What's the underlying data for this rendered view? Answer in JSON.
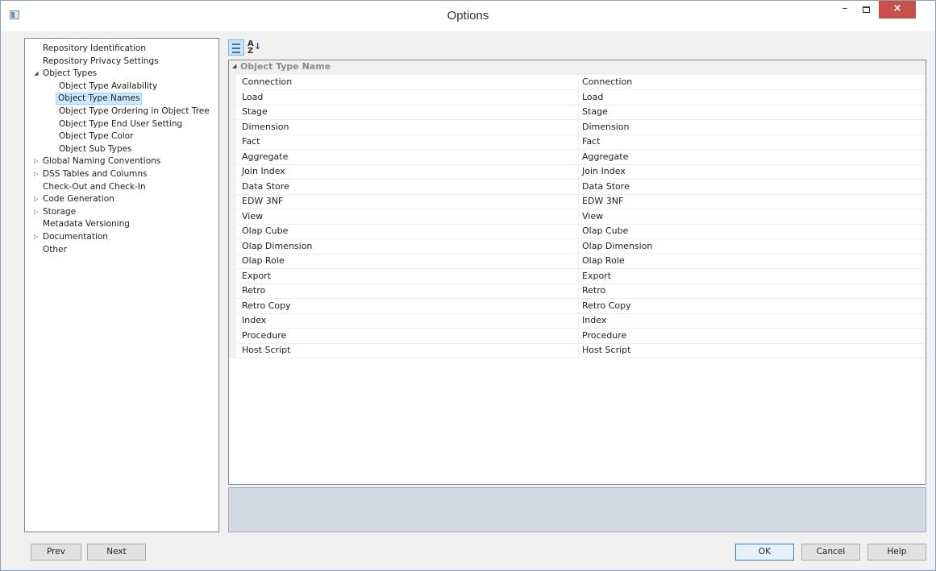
{
  "window": {
    "title": "Options",
    "minimize_glyph": "–",
    "close_glyph": "×"
  },
  "tree": [
    {
      "label": "Repository Identification",
      "level": 0,
      "toggle": ""
    },
    {
      "label": "Repository Privacy Settings",
      "level": 0,
      "toggle": ""
    },
    {
      "label": "Object Types",
      "level": 0,
      "toggle": "◢"
    },
    {
      "label": "Object Type Availability",
      "level": 1,
      "toggle": ""
    },
    {
      "label": "Object Type Names",
      "level": 1,
      "toggle": "",
      "selected": true
    },
    {
      "label": "Object Type Ordering in Object Tree",
      "level": 1,
      "toggle": ""
    },
    {
      "label": "Object Type End User Setting",
      "level": 1,
      "toggle": ""
    },
    {
      "label": "Object Type Color",
      "level": 1,
      "toggle": ""
    },
    {
      "label": "Object Sub Types",
      "level": 1,
      "toggle": ""
    },
    {
      "label": "Global Naming Conventions",
      "level": 0,
      "toggle": "▷"
    },
    {
      "label": "DSS Tables and Columns",
      "level": 0,
      "toggle": "▷"
    },
    {
      "label": "Check-Out and Check-In",
      "level": 0,
      "toggle": ""
    },
    {
      "label": "Code Generation",
      "level": 0,
      "toggle": "▷"
    },
    {
      "label": "Storage",
      "level": 0,
      "toggle": "▷"
    },
    {
      "label": "Metadata Versioning",
      "level": 0,
      "toggle": ""
    },
    {
      "label": "Documentation",
      "level": 0,
      "toggle": "▷"
    },
    {
      "label": "Other",
      "level": 0,
      "toggle": ""
    }
  ],
  "toolbar": {
    "categorized_icon": "categorized-view-icon",
    "alpha_sort_icon": "sort-alphabetical-icon",
    "alpha_glyph_top": "A",
    "alpha_glyph_bottom": "Z",
    "alpha_arrow": "↓"
  },
  "grid": {
    "category": {
      "label": "Object Type Name",
      "toggle": "◢"
    },
    "rows": [
      {
        "name": "Connection",
        "value": "Connection"
      },
      {
        "name": "Load",
        "value": "Load"
      },
      {
        "name": "Stage",
        "value": "Stage"
      },
      {
        "name": "Dimension",
        "value": "Dimension"
      },
      {
        "name": "Fact",
        "value": "Fact"
      },
      {
        "name": "Aggregate",
        "value": "Aggregate"
      },
      {
        "name": "Join Index",
        "value": "Join Index"
      },
      {
        "name": "Data Store",
        "value": "Data Store"
      },
      {
        "name": "EDW 3NF",
        "value": "EDW 3NF"
      },
      {
        "name": "View",
        "value": "View"
      },
      {
        "name": "Olap Cube",
        "value": "Olap Cube"
      },
      {
        "name": "Olap Dimension",
        "value": "Olap Dimension"
      },
      {
        "name": "Olap Role",
        "value": "Olap Role"
      },
      {
        "name": "Export",
        "value": "Export"
      },
      {
        "name": "Retro",
        "value": "Retro"
      },
      {
        "name": "Retro Copy",
        "value": "Retro Copy"
      },
      {
        "name": "Index",
        "value": "Index"
      },
      {
        "name": "Procedure",
        "value": "Procedure"
      },
      {
        "name": "Host Script",
        "value": "Host Script"
      }
    ]
  },
  "buttons": {
    "prev": "Prev",
    "next": "Next",
    "ok": "OK",
    "cancel": "Cancel",
    "help": "Help"
  }
}
